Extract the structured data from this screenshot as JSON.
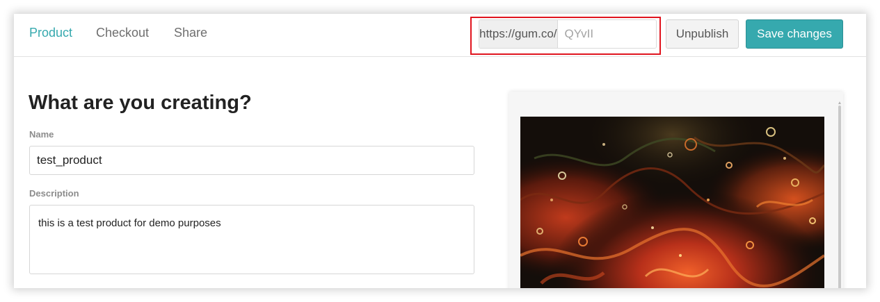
{
  "nav": {
    "tabs": [
      {
        "label": "Product",
        "active": true
      },
      {
        "label": "Checkout",
        "active": false
      },
      {
        "label": "Share",
        "active": false
      }
    ]
  },
  "url": {
    "prefix": "https://gum.co/",
    "slug_placeholder": "QYvII"
  },
  "actions": {
    "unpublish_label": "Unpublish",
    "save_label": "Save changes"
  },
  "form": {
    "title": "What are you creating?",
    "name_label": "Name",
    "name_value": "test_product",
    "description_label": "Description",
    "description_value": "this is a test product for demo purposes"
  },
  "preview": {
    "cover_image": "abstract-fluid-art-image"
  },
  "colors": {
    "accent": "#36a9ae",
    "highlight": "#e0141e",
    "tab_inactive": "#6f6f6f"
  }
}
